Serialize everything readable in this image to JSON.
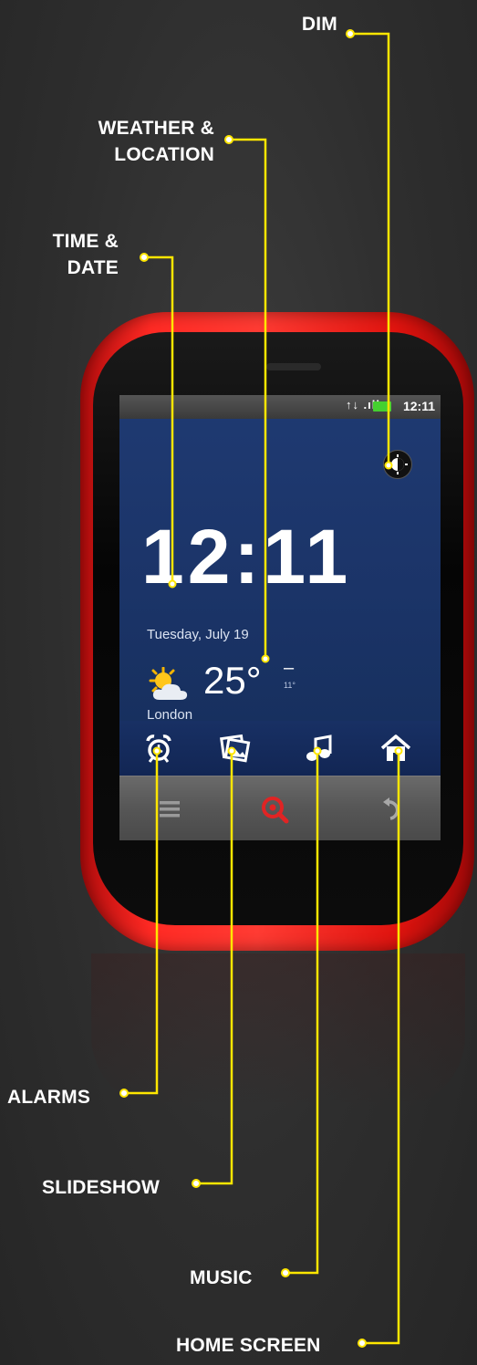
{
  "callouts": {
    "dim": "DIM",
    "weather_line1": "WEATHER &",
    "weather_line2": "LOCATION",
    "time_line1": "TIME &",
    "time_line2": "DATE",
    "alarms": "ALARMS",
    "slideshow": "SLIDESHOW",
    "music": "MUSIC",
    "home_screen": "HOME SCREEN"
  },
  "screen": {
    "status_time": "12:11",
    "signal_text": "↑↓ .ıll",
    "time": "12:11",
    "date": "Tuesday, July 19",
    "temperature": "25°",
    "temp_dash": "–",
    "low_temp": "11°",
    "location": "London"
  },
  "dock": [
    "alarm-clock-icon",
    "slideshow-icon",
    "music-note-icon",
    "home-icon"
  ],
  "softkeys": [
    "menu-icon",
    "search-icon",
    "back-icon"
  ],
  "colors": {
    "callout_line": "#ffe600",
    "phone_body": "#ff2a24",
    "screen_bg": "#1f3a72",
    "search_accent": "#e02424",
    "battery": "#45d030"
  }
}
